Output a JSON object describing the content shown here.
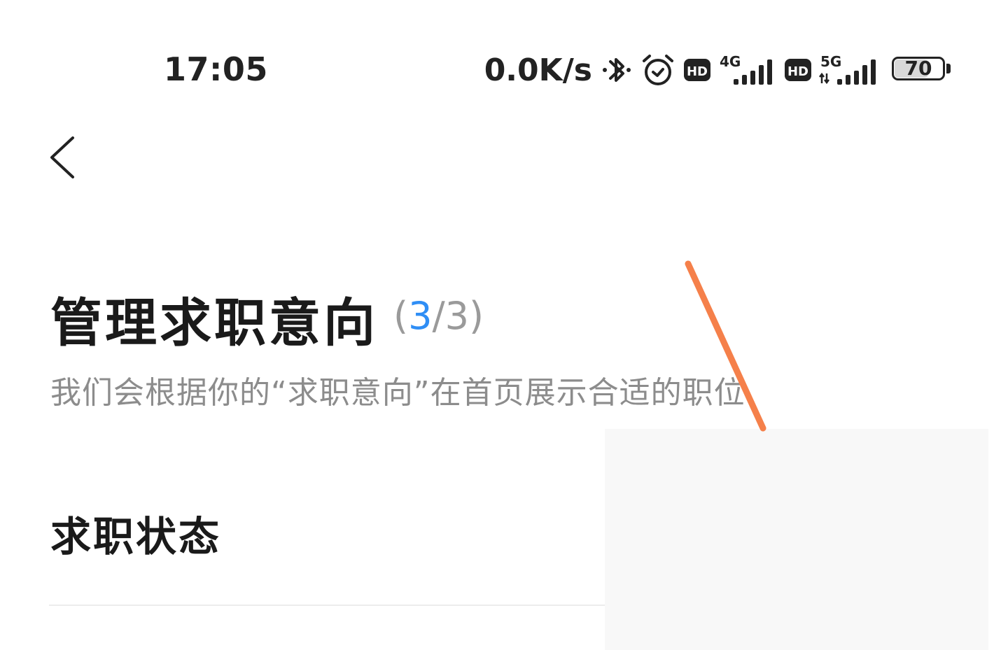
{
  "status_bar": {
    "time": "17:05",
    "net_speed": "0.0K/s",
    "battery_level": "70",
    "battery_fraction": 0.7,
    "hd_badge": "HD",
    "network_1": "4G",
    "network_2": "5G"
  },
  "header": {
    "title": "管理求职意向",
    "counter_open": "(",
    "counter_current": "3",
    "counter_rest": "/3)",
    "subtitle": "我们会根据你的“求职意向”在首页展示合适的职位"
  },
  "section": {
    "title": "求职状态"
  },
  "colors": {
    "accent": "#2f8ef5",
    "annotation": "#f5804a",
    "text_primary": "#1a1a1a",
    "text_secondary": "#8c8c8c"
  },
  "icons": {
    "back": "chevron-left-icon",
    "bluetooth": "bluetooth-icon",
    "alarm": "alarm-icon",
    "signal": "signal-bars-icon"
  }
}
